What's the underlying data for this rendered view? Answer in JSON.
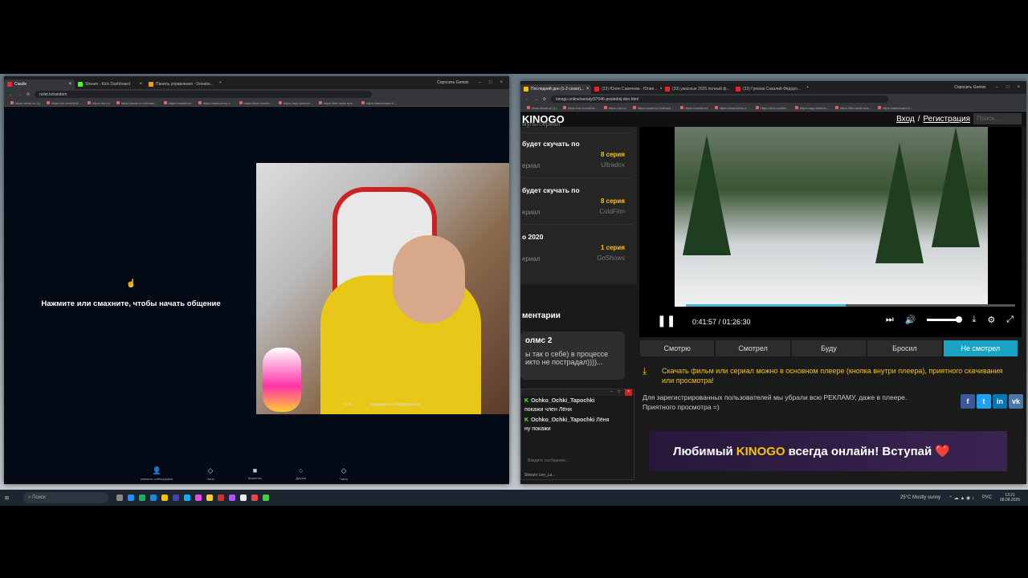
{
  "left_window": {
    "tabs": [
      {
        "label": "Смайк"
      },
      {
        "label": "Stream - Kick Dashboard"
      },
      {
        "label": "Панель управления - Donatio..."
      }
    ],
    "ask_gemini": "Спросить Gemini",
    "url": "nvlet.tv/random",
    "bookmarks": [
      "https://mail.ru/ (1)",
      "https://vk.com/id18...",
      "https://ok.ru/",
      "https://www.vo.r/c/frank...",
      "https://rorabk.ru/",
      "https://www.temu.c...",
      "https://kick.com/fe...",
      "https://app.mineva...",
      "https://the-radio.ru/s...",
      "https://dashboard.li..."
    ],
    "start_text": "Нажмите или смахните, чтобы начать общение",
    "video_labels": [
      "Все",
      "медиацентр оборудование"
    ],
    "bottom_items": [
      "сменить собеседника",
      "Чаты",
      "Моменты",
      "Друзья",
      "Чаты"
    ]
  },
  "right_window": {
    "tabs": [
      {
        "label": "Последний дон (1-2 сезон)..."
      },
      {
        "label": "(33) Юлия Савичева - Юлия..."
      },
      {
        "label": "(33) ужасные 2025 полный ф..."
      },
      {
        "label": "(33) Громов Сахалий Фёдоро..."
      }
    ],
    "ask_gemini": "Спросить Gemini",
    "url": "kinogo.online/serialy/37046-poslednij-don.html",
    "site": {
      "logo": "KINOGO",
      "login": "Вход",
      "sep": "/",
      "register": "Регистрация",
      "search_placeholder": "Поиск...",
      "sidebar": [
        {
          "title": "мультсериал",
          "episode": "",
          "genre": "",
          "studio": ""
        },
        {
          "title": "будет скучать по",
          "episode": "8 серия",
          "genre": "ериал",
          "studio": "Ultradox"
        },
        {
          "title": "будет скучать по",
          "episode": "8 серия",
          "genre": "ериал",
          "studio": "ColdFilm"
        },
        {
          "title": "о  2020",
          "episode": "1 серия",
          "genre": "ериал",
          "studio": "GoShows"
        }
      ],
      "comments_header": "ментарии",
      "comment_author": "олмс 2",
      "comment_text": "ы так о себе) в процессе икто не пострадал))))...",
      "player": {
        "time": "0:41:57 / 01:26:30",
        "progress": 0.485,
        "volume": 0.85
      },
      "status_tabs": [
        "Смотрю",
        "Смотрел",
        "Буду",
        "Бросил",
        "Не смотрел"
      ],
      "active_status": "Не смотрел",
      "download_text": "Скачать фильм или сериал можно в основном плеере (кнопка внутри плеера), приятного скачивания или просмотра!",
      "info_text": "Для зарегистрированных пользователей мы убрали всю РЕКЛАМУ, даже в плеере. Приятного просмотра =)",
      "social": [
        "f",
        "t",
        "in",
        "vk"
      ],
      "banner_pre": "Любимый",
      "banner_brand": "KINOGO",
      "banner_post": "всегда онлайн! Вступай ❤️"
    }
  },
  "chat": {
    "messages": [
      {
        "user": "Ochko_Ochki_Tapochki",
        "text": "покажи член Лёня"
      },
      {
        "user": "Ochko_Ochki_Tapochki",
        "text": "ну покажи",
        "addressee": "Лёня"
      }
    ],
    "placeholder": "Введите сообщение...",
    "footer": "Stream Leo_La..."
  },
  "taskbar": {
    "search": "Поиск",
    "weather": "25°C  Mostly sunny",
    "lang": "РУС",
    "time": "13:21",
    "date": "08.08.2025"
  },
  "colors": {
    "accent": "#18a3c2",
    "brand_yellow": "#f5c400",
    "kick_green": "#53fc18"
  }
}
